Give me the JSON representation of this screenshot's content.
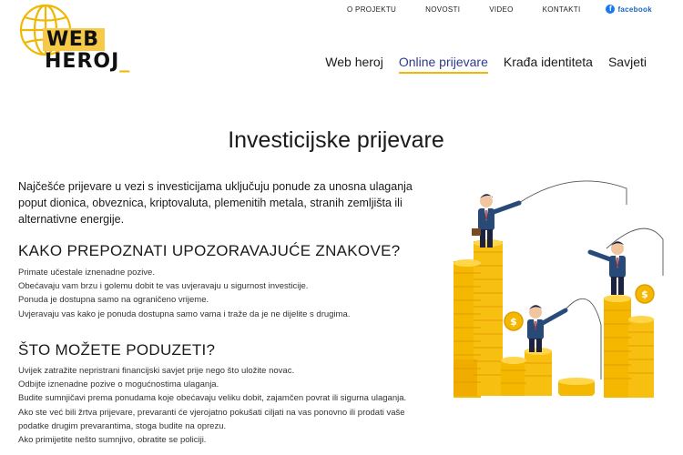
{
  "logo": {
    "line1": "WEB",
    "line2": "HEROJ",
    "cursor": "_"
  },
  "top_nav": [
    {
      "label": "O PROJEKTU"
    },
    {
      "label": "NOVOSTI"
    },
    {
      "label": "VIDEO"
    },
    {
      "label": "KONTAKTI"
    }
  ],
  "facebook": {
    "label": "facebook",
    "icon": "facebook-icon",
    "color": "#1877f2"
  },
  "main_nav": [
    {
      "label": "Web heroj"
    },
    {
      "label": "Online prijevare",
      "active": true
    },
    {
      "label": "Krađa identiteta"
    },
    {
      "label": "Savjeti"
    }
  ],
  "page": {
    "title": "Investicijske prijevare",
    "intro": "Najčešće prijevare u vezi s investicijama uključuju ponude za unosna ulaganja poput dionica, obveznica, kriptovaluta, plemenitih metala, stranih zemljišta ili alternativne energije.",
    "section1": {
      "heading": "KAKO PREPOZNATI UPOZORAVAJUĆE ZNAKOVE?",
      "items": [
        "Primate učestale iznenadne pozive.",
        "Obećavaju vam brzu i golemu dobit te vas uvjeravaju u sigurnost investicije.",
        "Ponuda je dostupna samo na ograničeno vrijeme.",
        "Uvjeravaju vas kako je ponuda dostupna samo vama i traže da je ne dijelite s drugima."
      ]
    },
    "section2": {
      "heading": "ŠTO MOŽETE PODUZETI?",
      "items": [
        "Uvijek zatražite nepristrani financijski savjet prije nego što uložite novac.",
        "Odbijte iznenadne pozive o mogućnostima ulaganja.",
        "Budite sumnjičavi prema ponudama koje obećavaju veliku dobit, zajamčen povrat ili sigurna ulaganja.",
        "Ako ste već bili žrtva prijevare, prevaranti će vjerojatno pokušati ciljati na vas ponovno ili prodati vaše podatke drugim prevarantima, stoga budite na oprezu.",
        "Ako primijetite nešto sumnjivo, obratite se policiji."
      ]
    }
  },
  "colors": {
    "accent": "#f2b705",
    "active_nav": "#2d3a8c",
    "coin": "#f5b800"
  }
}
